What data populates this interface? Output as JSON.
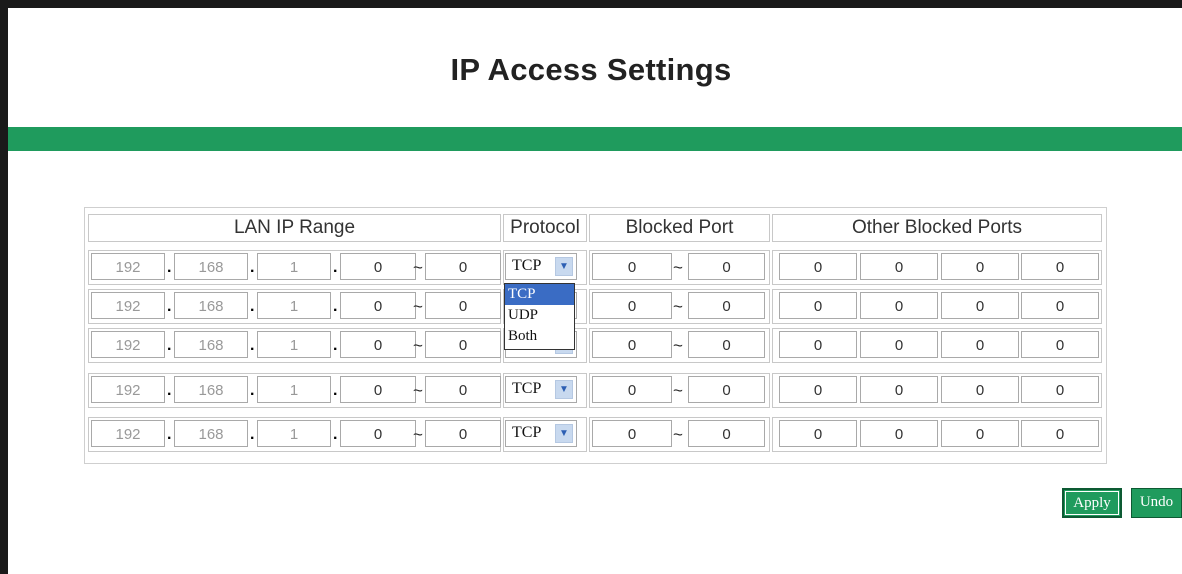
{
  "page": {
    "title": "IP Access Settings",
    "accent_color": "#1f9b5d"
  },
  "table": {
    "headers": [
      "LAN IP Range",
      "Protocol",
      "Blocked Port",
      "Other Blocked Ports"
    ],
    "rows": [
      {
        "ip": [
          "192",
          "168",
          "1",
          "0",
          "0"
        ],
        "protocol": "TCP",
        "port": [
          "0",
          "0"
        ],
        "other": [
          "0",
          "0",
          "0",
          "0"
        ]
      },
      {
        "ip": [
          "192",
          "168",
          "1",
          "0",
          "0"
        ],
        "protocol": "TCP",
        "port": [
          "0",
          "0"
        ],
        "other": [
          "0",
          "0",
          "0",
          "0"
        ]
      },
      {
        "ip": [
          "192",
          "168",
          "1",
          "0",
          "0"
        ],
        "protocol": "TCP",
        "port": [
          "0",
          "0"
        ],
        "other": [
          "0",
          "0",
          "0",
          "0"
        ]
      },
      {
        "ip": [
          "192",
          "168",
          "1",
          "0",
          "0"
        ],
        "protocol": "TCP",
        "port": [
          "0",
          "0"
        ],
        "other": [
          "0",
          "0",
          "0",
          "0"
        ]
      },
      {
        "ip": [
          "192",
          "168",
          "1",
          "0",
          "0"
        ],
        "protocol": "TCP",
        "port": [
          "0",
          "0"
        ],
        "other": [
          "0",
          "0",
          "0",
          "0"
        ]
      }
    ],
    "separators": {
      "dot": ".",
      "range": "~"
    }
  },
  "protocol_dropdown": {
    "open_row": 0,
    "options": [
      "TCP",
      "UDP",
      "Both"
    ],
    "highlighted": "TCP",
    "arrow_icon": "chevron-down-icon"
  },
  "buttons": {
    "apply_label": "Apply",
    "undo_label": "Undo"
  }
}
